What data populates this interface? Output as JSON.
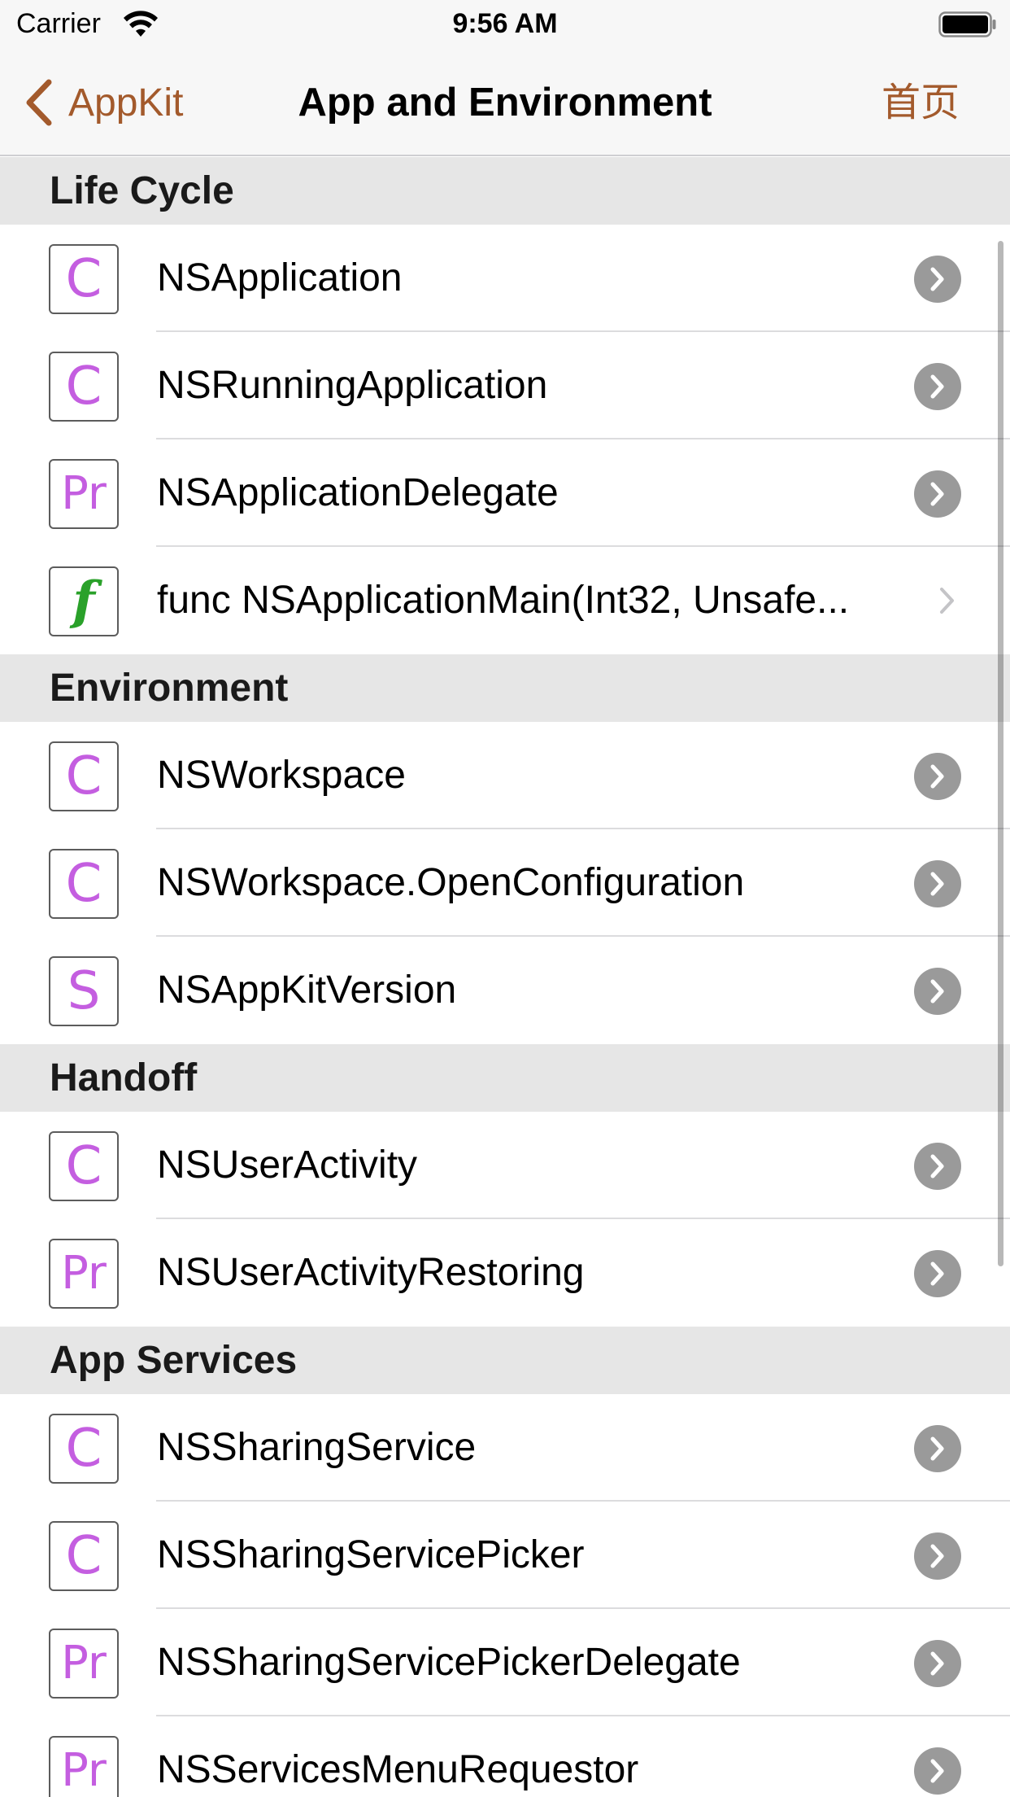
{
  "status_bar": {
    "carrier": "Carrier",
    "time": "9:56 AM"
  },
  "nav": {
    "back_label": "AppKit",
    "title": "App and Environment",
    "home_label": "首页"
  },
  "sections": [
    {
      "title": "Life Cycle",
      "rows": [
        {
          "badge": "C",
          "kind": "class",
          "label": "NSApplication",
          "accessory": "detail-disclosure"
        },
        {
          "badge": "C",
          "kind": "class",
          "label": "NSRunningApplication",
          "accessory": "detail-disclosure"
        },
        {
          "badge": "Pr",
          "kind": "protocol",
          "label": "NSApplicationDelegate",
          "accessory": "detail-disclosure"
        },
        {
          "badge": "f",
          "kind": "function",
          "label": "func NSApplicationMain(Int32, Unsafe...",
          "accessory": "chevron"
        }
      ]
    },
    {
      "title": "Environment",
      "rows": [
        {
          "badge": "C",
          "kind": "class",
          "label": "NSWorkspace",
          "accessory": "detail-disclosure"
        },
        {
          "badge": "C",
          "kind": "class",
          "label": "NSWorkspace.OpenConfiguration",
          "accessory": "detail-disclosure"
        },
        {
          "badge": "S",
          "kind": "struct",
          "label": "NSAppKitVersion",
          "accessory": "detail-disclosure"
        }
      ]
    },
    {
      "title": "Handoff",
      "rows": [
        {
          "badge": "C",
          "kind": "class",
          "label": "NSUserActivity",
          "accessory": "detail-disclosure"
        },
        {
          "badge": "Pr",
          "kind": "protocol",
          "label": "NSUserActivityRestoring",
          "accessory": "detail-disclosure"
        }
      ]
    },
    {
      "title": "App Services",
      "rows": [
        {
          "badge": "C",
          "kind": "class",
          "label": "NSSharingService",
          "accessory": "detail-disclosure"
        },
        {
          "badge": "C",
          "kind": "class",
          "label": "NSSharingServicePicker",
          "accessory": "detail-disclosure"
        },
        {
          "badge": "Pr",
          "kind": "protocol",
          "label": "NSSharingServicePickerDelegate",
          "accessory": "detail-disclosure"
        },
        {
          "badge": "Pr",
          "kind": "protocol",
          "label": "NSServicesMenuRequestor",
          "accessory": "detail-disclosure"
        }
      ]
    }
  ],
  "colors": {
    "accent": "#a35a2c",
    "badge_text": "#c45ee0",
    "function_badge": "#2aa12a",
    "section_bg": "#e6e6e6"
  }
}
